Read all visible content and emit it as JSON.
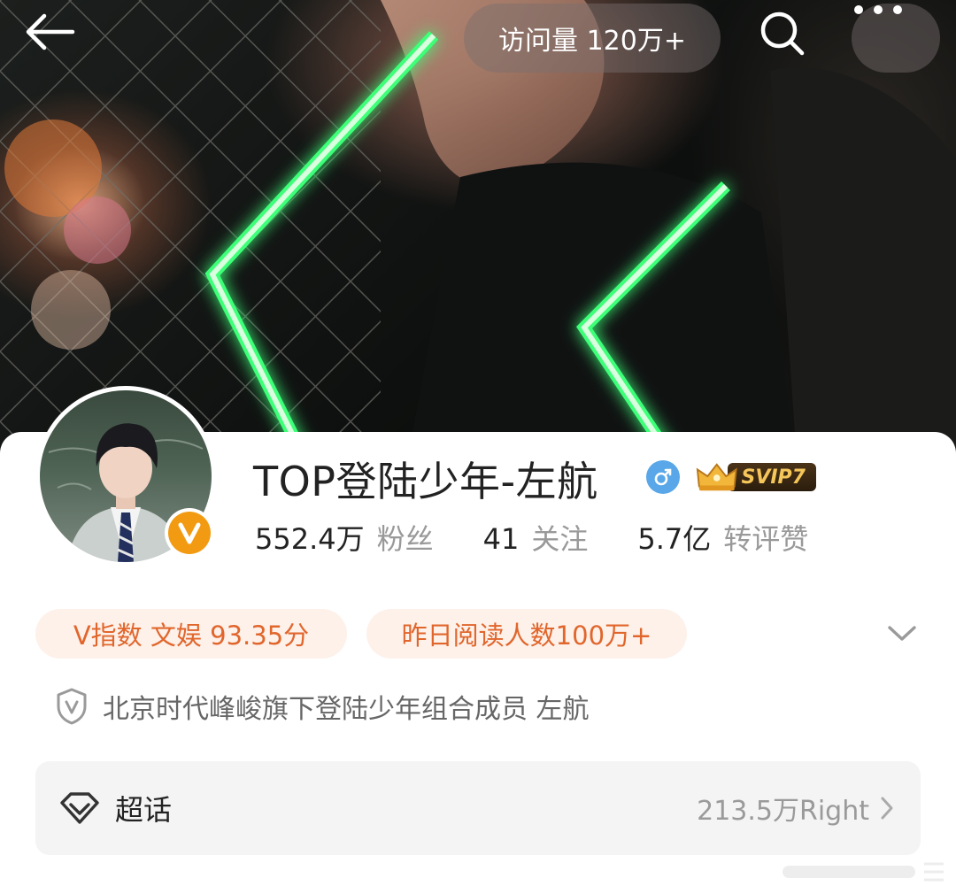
{
  "header": {
    "visits_label": "访问量 120万+",
    "back_icon": "arrow-left-icon",
    "search_icon": "search-icon",
    "more_icon": "more-dots-icon"
  },
  "profile": {
    "name": "TOP登陆少年-左航",
    "gender_icon": "male-icon",
    "verified_badge": "V",
    "svip_label": "SVIP7",
    "stats": [
      {
        "value": "552.4万",
        "label": "粉丝"
      },
      {
        "value": "41",
        "label": "关注"
      },
      {
        "value": "5.7亿",
        "label": "转评赞"
      }
    ]
  },
  "tags": {
    "v_index": "V指数 文娱 93.35分",
    "yesterday_reads": "昨日阅读人数100万+"
  },
  "certification": {
    "text": "北京时代峰峻旗下登陆少年组合成员 左航"
  },
  "super_topic": {
    "label": "超话",
    "count": "213.5万Right"
  },
  "colors": {
    "accent_orange": "#e1662c",
    "pill_bg": "#fdf1ea",
    "verified_orange": "#f29b12",
    "gender_blue": "#59a7e8",
    "svip_gold": "#f5c65a"
  }
}
